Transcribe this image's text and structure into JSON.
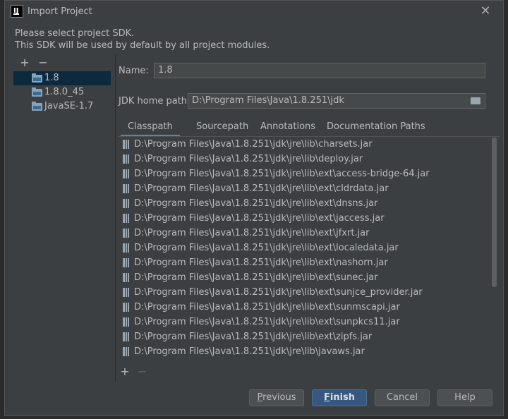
{
  "window": {
    "title": "Import Project"
  },
  "description": {
    "line1": "Please select project SDK.",
    "line2": "This SDK will be used by default by all project modules."
  },
  "sdk_toolbar": {
    "add": "+",
    "remove": "−"
  },
  "sdk_list": [
    {
      "label": "1.8",
      "selected": true
    },
    {
      "label": "1.8.0_45",
      "selected": false
    },
    {
      "label": "JavaSE-1.7",
      "selected": false
    }
  ],
  "name_field": {
    "label": "Name:",
    "value": "1.8"
  },
  "jdk_home": {
    "label": "JDK home path:",
    "value": "D:\\Program Files\\Java\\1.8.251\\jdk"
  },
  "tabs": [
    "Classpath",
    "Sourcepath",
    "Annotations",
    "Documentation Paths"
  ],
  "classpath": [
    "D:\\Program Files\\Java\\1.8.251\\jdk\\jre\\lib\\charsets.jar",
    "D:\\Program Files\\Java\\1.8.251\\jdk\\jre\\lib\\deploy.jar",
    "D:\\Program Files\\Java\\1.8.251\\jdk\\jre\\lib\\ext\\access-bridge-64.jar",
    "D:\\Program Files\\Java\\1.8.251\\jdk\\jre\\lib\\ext\\cldrdata.jar",
    "D:\\Program Files\\Java\\1.8.251\\jdk\\jre\\lib\\ext\\dnsns.jar",
    "D:\\Program Files\\Java\\1.8.251\\jdk\\jre\\lib\\ext\\jaccess.jar",
    "D:\\Program Files\\Java\\1.8.251\\jdk\\jre\\lib\\ext\\jfxrt.jar",
    "D:\\Program Files\\Java\\1.8.251\\jdk\\jre\\lib\\ext\\localedata.jar",
    "D:\\Program Files\\Java\\1.8.251\\jdk\\jre\\lib\\ext\\nashorn.jar",
    "D:\\Program Files\\Java\\1.8.251\\jdk\\jre\\lib\\ext\\sunec.jar",
    "D:\\Program Files\\Java\\1.8.251\\jdk\\jre\\lib\\ext\\sunjce_provider.jar",
    "D:\\Program Files\\Java\\1.8.251\\jdk\\jre\\lib\\ext\\sunmscapi.jar",
    "D:\\Program Files\\Java\\1.8.251\\jdk\\jre\\lib\\ext\\sunpkcs11.jar",
    "D:\\Program Files\\Java\\1.8.251\\jdk\\jre\\lib\\ext\\zipfs.jar",
    "D:\\Program Files\\Java\\1.8.251\\jdk\\jre\\lib\\javaws.jar"
  ],
  "classpath_toolbar": {
    "add": "+",
    "remove": "−"
  },
  "buttons": {
    "previous": {
      "mnemonic": "P",
      "rest": "revious"
    },
    "finish": {
      "mnemonic": "F",
      "rest": "inish"
    },
    "cancel": "Cancel",
    "help": "Help"
  },
  "colors": {
    "dialog_bg": "#3c3f41",
    "selection": "#0d293e",
    "accent": "#4a88c7",
    "primary_button": "#365880"
  }
}
